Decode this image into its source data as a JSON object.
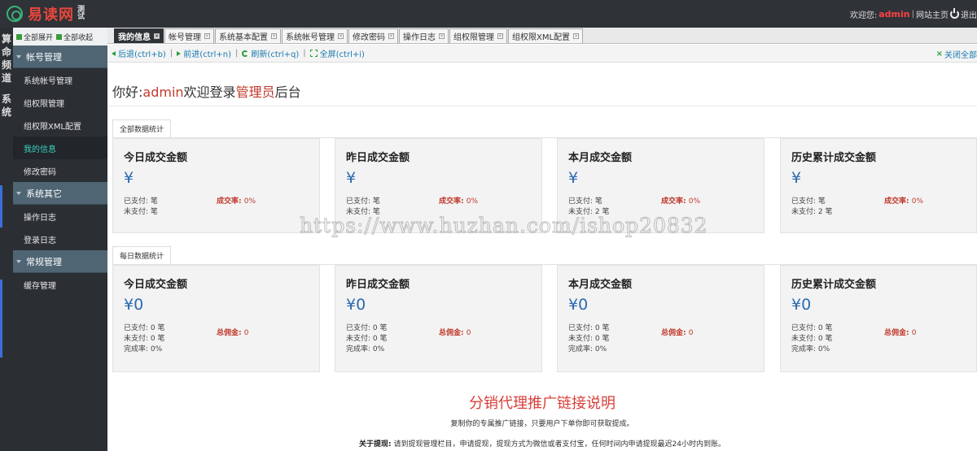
{
  "header": {
    "logo_text": "易读网",
    "logo_sub": "测 试",
    "welcome_prefix": "欢迎您:",
    "username": "admin",
    "separator": "|",
    "site_home": "网站主页",
    "exit": "退出"
  },
  "channels": [
    {
      "label": "算命频道"
    },
    {
      "label": "系统"
    }
  ],
  "sidebar": {
    "expand_all": "全部展开",
    "collapse_all": "全部收起",
    "groups": [
      {
        "label": "帐号管理",
        "items": [
          {
            "label": "系统帐号管理"
          },
          {
            "label": "组权限管理"
          },
          {
            "label": "组权限XML配置"
          },
          {
            "label": "我的信息"
          },
          {
            "label": "修改密码"
          }
        ]
      },
      {
        "label": "系统其它",
        "items": [
          {
            "label": "操作日志"
          },
          {
            "label": "登录日志"
          }
        ]
      },
      {
        "label": "常规管理",
        "items": [
          {
            "label": "缓存管理"
          }
        ]
      }
    ]
  },
  "tabs": [
    {
      "label": "我的信息"
    },
    {
      "label": "帐号管理"
    },
    {
      "label": "系统基本配置"
    },
    {
      "label": "系统帐号管理"
    },
    {
      "label": "修改密码"
    },
    {
      "label": "操作日志"
    },
    {
      "label": "组权限管理"
    },
    {
      "label": "组权限XML配置"
    }
  ],
  "toolbar": {
    "back": "后退(ctrl+b)",
    "forward": "前进(ctrl+n)",
    "refresh": "刷新(ctrl+q)",
    "fullscreen": "全屏(ctrl+i)",
    "divider": "|",
    "close_all": "关闭全部"
  },
  "welcome": {
    "prefix": "你好:",
    "username": "admin",
    "middle": "欢迎登录",
    "role": "管理员",
    "suffix": "后台"
  },
  "all_stats": {
    "tab_label": "全部数据统计",
    "cards": [
      {
        "title": "今日成交金额",
        "amount": "¥",
        "paid": "已支付: 笔",
        "unpaid": "未支付: 笔",
        "rate_label": "成交率:",
        "rate_value": "0%"
      },
      {
        "title": "昨日成交金额",
        "amount": "¥",
        "paid": "已支付: 笔",
        "unpaid": "未支付: 笔",
        "rate_label": "成交率:",
        "rate_value": "0%"
      },
      {
        "title": "本月成交金额",
        "amount": "¥",
        "paid": "已支付: 笔",
        "unpaid": "未支付: 2 笔",
        "rate_label": "成交率:",
        "rate_value": "0%"
      },
      {
        "title": "历史累计成交金额",
        "amount": "¥",
        "paid": "已支付: 笔",
        "unpaid": "未支付: 2 笔",
        "rate_label": "成交率:",
        "rate_value": "0%"
      }
    ]
  },
  "daily_stats": {
    "tab_label": "每日数据统计",
    "cards": [
      {
        "title": "今日成交金额",
        "amount": "¥0",
        "paid": "已支付: 0 笔",
        "unpaid": "未支付: 0 笔",
        "completion": "完成率: 0%",
        "comm_label": "总佣金:",
        "comm_value": "0"
      },
      {
        "title": "昨日成交金额",
        "amount": "¥0",
        "paid": "已支付: 0 笔",
        "unpaid": "未支付: 0 笔",
        "completion": "完成率: 0%",
        "comm_label": "总佣金:",
        "comm_value": "0"
      },
      {
        "title": "本月成交金额",
        "amount": "¥0",
        "paid": "已支付: 0 笔",
        "unpaid": "未支付: 0 笔",
        "completion": "完成率: 0%",
        "comm_label": "总佣金:",
        "comm_value": "0"
      },
      {
        "title": "历史累计成交金额",
        "amount": "¥0",
        "paid": "已支付: 0 笔",
        "unpaid": "未支付: 0 笔",
        "completion": "完成率: 0%",
        "comm_label": "总佣金:",
        "comm_value": "0"
      }
    ]
  },
  "distribution": {
    "title": "分销代理推广链接说明",
    "desc": "复制你的专属推广链接，只要用户下单你即可获取提成。",
    "about_label": "关于提现:",
    "about_text": "请到提现管理栏目，申请提现，提现方式为微信或者支付宝，任何时间内申请提现最迟24小时内到账。"
  },
  "watermark": "https://www.huzhan.com/ishop20832",
  "colors": {
    "header_bg": "#2f3338",
    "sidebar_group_bg": "#4f6573",
    "active_item_text": "#3bd1c3",
    "accent_red": "#c0392b",
    "amount_blue": "#2a6ab1",
    "toolbar_green": "#2e9d3b"
  }
}
